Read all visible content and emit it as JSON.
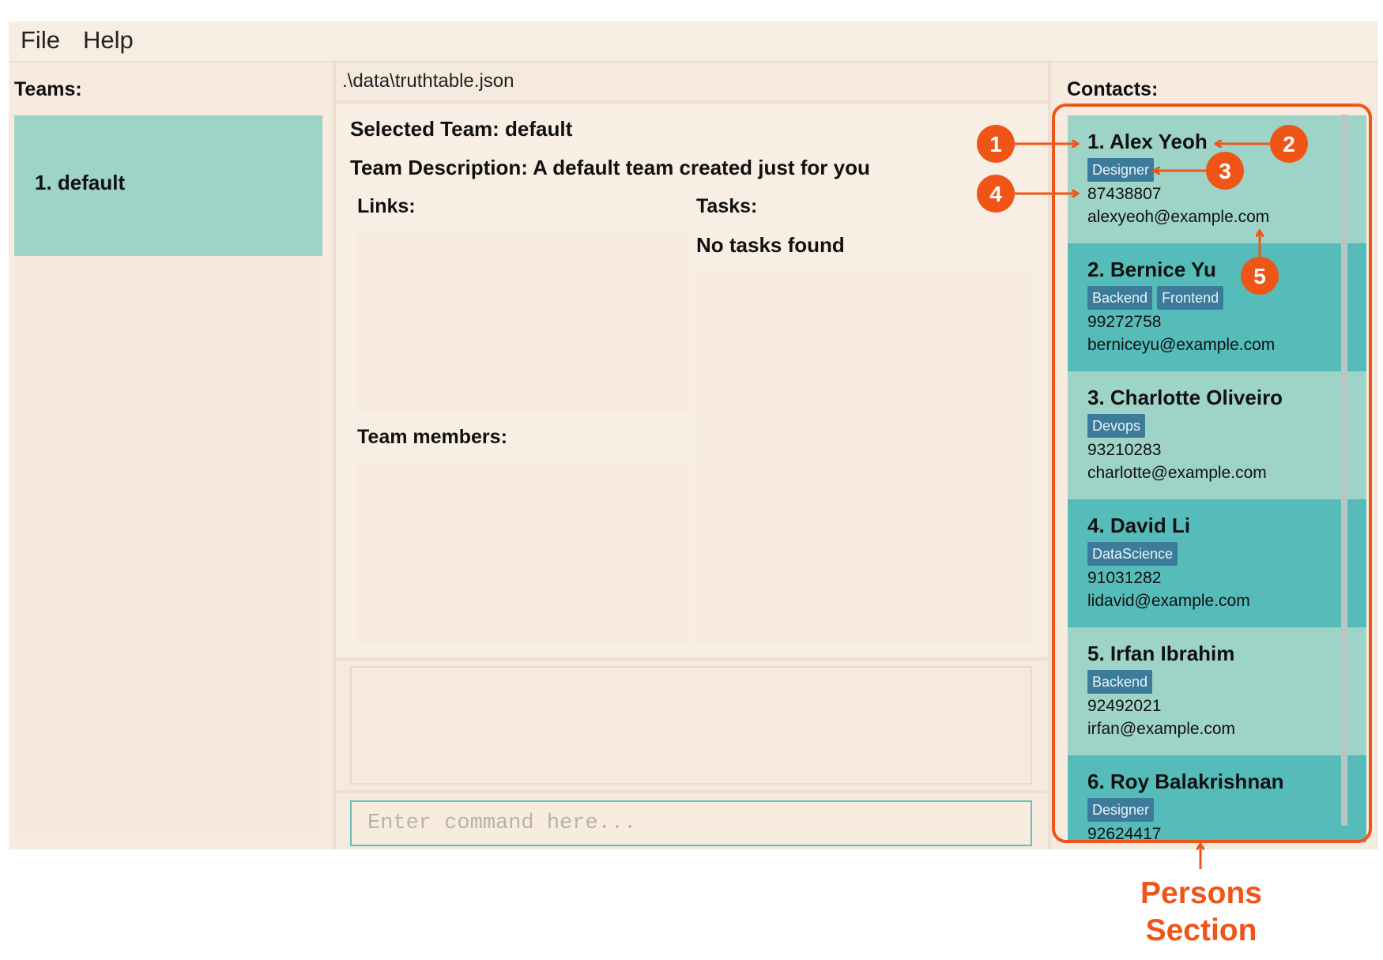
{
  "menu": {
    "file": "File",
    "help": "Help"
  },
  "teams": {
    "title": "Teams:",
    "items": [
      {
        "label": "1. default"
      }
    ]
  },
  "center": {
    "file_path": ".\\data\\truthtable.json",
    "selected_team": "Selected Team: default",
    "team_description": "Team Description: A default team created just for you",
    "links_title": "Links:",
    "tasks_title": "Tasks:",
    "tasks_empty": "No tasks found",
    "members_title": "Team members:",
    "command_placeholder": "Enter command here..."
  },
  "contacts": {
    "title": "Contacts:",
    "persons": [
      {
        "name": "1. Alex Yeoh",
        "tags": [
          "Designer"
        ],
        "phone": "87438807",
        "email": "alexyeoh@example.com"
      },
      {
        "name": "2. Bernice Yu",
        "tags": [
          "Backend",
          "Frontend"
        ],
        "phone": "99272758",
        "email": "berniceyu@example.com"
      },
      {
        "name": "3. Charlotte Oliveiro",
        "tags": [
          "Devops"
        ],
        "phone": "93210283",
        "email": "charlotte@example.com"
      },
      {
        "name": "4. David Li",
        "tags": [
          "DataScience"
        ],
        "phone": "91031282",
        "email": "lidavid@example.com"
      },
      {
        "name": "5. Irfan Ibrahim",
        "tags": [
          "Backend"
        ],
        "phone": "92492021",
        "email": "irfan@example.com"
      },
      {
        "name": "6. Roy Balakrishnan",
        "tags": [
          "Designer"
        ],
        "phone": "92624417",
        "email": ""
      }
    ]
  },
  "annotations": {
    "markers": [
      "1",
      "2",
      "3",
      "4",
      "5"
    ],
    "section_label_line1": "Persons",
    "section_label_line2": "Section",
    "color": "#f05518"
  },
  "colors": {
    "card_light": "#9ed3c7",
    "card_dark": "#55bcba",
    "tag_bg": "#3c7c9a",
    "panel_bg": "#f7ebe0",
    "command_border": "#62bfc0"
  }
}
